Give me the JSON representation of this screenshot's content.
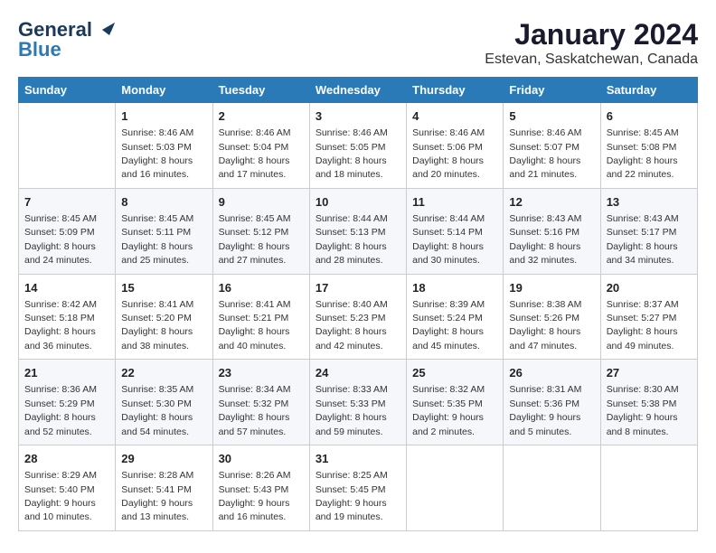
{
  "logo": {
    "line1": "General",
    "line2": "Blue"
  },
  "title": "January 2024",
  "location": "Estevan, Saskatchewan, Canada",
  "weekdays": [
    "Sunday",
    "Monday",
    "Tuesday",
    "Wednesday",
    "Thursday",
    "Friday",
    "Saturday"
  ],
  "weeks": [
    [
      {
        "day": "",
        "sunrise": "",
        "sunset": "",
        "daylight": ""
      },
      {
        "day": "1",
        "sunrise": "Sunrise: 8:46 AM",
        "sunset": "Sunset: 5:03 PM",
        "daylight": "Daylight: 8 hours and 16 minutes."
      },
      {
        "day": "2",
        "sunrise": "Sunrise: 8:46 AM",
        "sunset": "Sunset: 5:04 PM",
        "daylight": "Daylight: 8 hours and 17 minutes."
      },
      {
        "day": "3",
        "sunrise": "Sunrise: 8:46 AM",
        "sunset": "Sunset: 5:05 PM",
        "daylight": "Daylight: 8 hours and 18 minutes."
      },
      {
        "day": "4",
        "sunrise": "Sunrise: 8:46 AM",
        "sunset": "Sunset: 5:06 PM",
        "daylight": "Daylight: 8 hours and 20 minutes."
      },
      {
        "day": "5",
        "sunrise": "Sunrise: 8:46 AM",
        "sunset": "Sunset: 5:07 PM",
        "daylight": "Daylight: 8 hours and 21 minutes."
      },
      {
        "day": "6",
        "sunrise": "Sunrise: 8:45 AM",
        "sunset": "Sunset: 5:08 PM",
        "daylight": "Daylight: 8 hours and 22 minutes."
      }
    ],
    [
      {
        "day": "7",
        "sunrise": "Sunrise: 8:45 AM",
        "sunset": "Sunset: 5:09 PM",
        "daylight": "Daylight: 8 hours and 24 minutes."
      },
      {
        "day": "8",
        "sunrise": "Sunrise: 8:45 AM",
        "sunset": "Sunset: 5:11 PM",
        "daylight": "Daylight: 8 hours and 25 minutes."
      },
      {
        "day": "9",
        "sunrise": "Sunrise: 8:45 AM",
        "sunset": "Sunset: 5:12 PM",
        "daylight": "Daylight: 8 hours and 27 minutes."
      },
      {
        "day": "10",
        "sunrise": "Sunrise: 8:44 AM",
        "sunset": "Sunset: 5:13 PM",
        "daylight": "Daylight: 8 hours and 28 minutes."
      },
      {
        "day": "11",
        "sunrise": "Sunrise: 8:44 AM",
        "sunset": "Sunset: 5:14 PM",
        "daylight": "Daylight: 8 hours and 30 minutes."
      },
      {
        "day": "12",
        "sunrise": "Sunrise: 8:43 AM",
        "sunset": "Sunset: 5:16 PM",
        "daylight": "Daylight: 8 hours and 32 minutes."
      },
      {
        "day": "13",
        "sunrise": "Sunrise: 8:43 AM",
        "sunset": "Sunset: 5:17 PM",
        "daylight": "Daylight: 8 hours and 34 minutes."
      }
    ],
    [
      {
        "day": "14",
        "sunrise": "Sunrise: 8:42 AM",
        "sunset": "Sunset: 5:18 PM",
        "daylight": "Daylight: 8 hours and 36 minutes."
      },
      {
        "day": "15",
        "sunrise": "Sunrise: 8:41 AM",
        "sunset": "Sunset: 5:20 PM",
        "daylight": "Daylight: 8 hours and 38 minutes."
      },
      {
        "day": "16",
        "sunrise": "Sunrise: 8:41 AM",
        "sunset": "Sunset: 5:21 PM",
        "daylight": "Daylight: 8 hours and 40 minutes."
      },
      {
        "day": "17",
        "sunrise": "Sunrise: 8:40 AM",
        "sunset": "Sunset: 5:23 PM",
        "daylight": "Daylight: 8 hours and 42 minutes."
      },
      {
        "day": "18",
        "sunrise": "Sunrise: 8:39 AM",
        "sunset": "Sunset: 5:24 PM",
        "daylight": "Daylight: 8 hours and 45 minutes."
      },
      {
        "day": "19",
        "sunrise": "Sunrise: 8:38 AM",
        "sunset": "Sunset: 5:26 PM",
        "daylight": "Daylight: 8 hours and 47 minutes."
      },
      {
        "day": "20",
        "sunrise": "Sunrise: 8:37 AM",
        "sunset": "Sunset: 5:27 PM",
        "daylight": "Daylight: 8 hours and 49 minutes."
      }
    ],
    [
      {
        "day": "21",
        "sunrise": "Sunrise: 8:36 AM",
        "sunset": "Sunset: 5:29 PM",
        "daylight": "Daylight: 8 hours and 52 minutes."
      },
      {
        "day": "22",
        "sunrise": "Sunrise: 8:35 AM",
        "sunset": "Sunset: 5:30 PM",
        "daylight": "Daylight: 8 hours and 54 minutes."
      },
      {
        "day": "23",
        "sunrise": "Sunrise: 8:34 AM",
        "sunset": "Sunset: 5:32 PM",
        "daylight": "Daylight: 8 hours and 57 minutes."
      },
      {
        "day": "24",
        "sunrise": "Sunrise: 8:33 AM",
        "sunset": "Sunset: 5:33 PM",
        "daylight": "Daylight: 8 hours and 59 minutes."
      },
      {
        "day": "25",
        "sunrise": "Sunrise: 8:32 AM",
        "sunset": "Sunset: 5:35 PM",
        "daylight": "Daylight: 9 hours and 2 minutes."
      },
      {
        "day": "26",
        "sunrise": "Sunrise: 8:31 AM",
        "sunset": "Sunset: 5:36 PM",
        "daylight": "Daylight: 9 hours and 5 minutes."
      },
      {
        "day": "27",
        "sunrise": "Sunrise: 8:30 AM",
        "sunset": "Sunset: 5:38 PM",
        "daylight": "Daylight: 9 hours and 8 minutes."
      }
    ],
    [
      {
        "day": "28",
        "sunrise": "Sunrise: 8:29 AM",
        "sunset": "Sunset: 5:40 PM",
        "daylight": "Daylight: 9 hours and 10 minutes."
      },
      {
        "day": "29",
        "sunrise": "Sunrise: 8:28 AM",
        "sunset": "Sunset: 5:41 PM",
        "daylight": "Daylight: 9 hours and 13 minutes."
      },
      {
        "day": "30",
        "sunrise": "Sunrise: 8:26 AM",
        "sunset": "Sunset: 5:43 PM",
        "daylight": "Daylight: 9 hours and 16 minutes."
      },
      {
        "day": "31",
        "sunrise": "Sunrise: 8:25 AM",
        "sunset": "Sunset: 5:45 PM",
        "daylight": "Daylight: 9 hours and 19 minutes."
      },
      {
        "day": "",
        "sunrise": "",
        "sunset": "",
        "daylight": ""
      },
      {
        "day": "",
        "sunrise": "",
        "sunset": "",
        "daylight": ""
      },
      {
        "day": "",
        "sunrise": "",
        "sunset": "",
        "daylight": ""
      }
    ]
  ]
}
